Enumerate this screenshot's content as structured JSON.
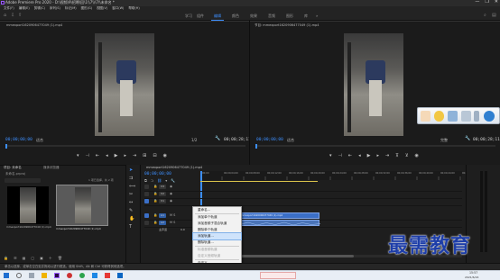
{
  "window": {
    "title": "Adobe Premiere Pro 2020 - D:\\视频\\9\\招聘\\回\\1\\\\7\\\\\\7\\\\未命名 *",
    "controls": [
      "—",
      "❐",
      "✕"
    ]
  },
  "menubar": [
    "文件(F)",
    "编辑(E)",
    "剪辑(C)",
    "序列(S)",
    "标记(M)",
    "图形(G)",
    "视图(V)",
    "窗口(W)",
    "帮助(H)"
  ],
  "workspaces": {
    "tabs": [
      "学习",
      "组件",
      "编辑",
      "颜色",
      "效果",
      "音频",
      "图形",
      "库",
      "»"
    ],
    "active": "编辑"
  },
  "source_monitor": {
    "tab": "源: (无剪辑)",
    "clip_tab": "mmexport1620906477049 (1).mp4",
    "timecode_left": "00;00;00;00",
    "fit": "适合",
    "ratio": "1/2",
    "timecode_right": "00;00;28;11"
  },
  "program_monitor": {
    "tab": "节目: mmexport1620906477049 (1).mp4",
    "timecode_left": "00;00;00;00",
    "fit": "适合",
    "ratio": "完整",
    "timecode_right": "00;00;28;11"
  },
  "project_panel": {
    "tabs": [
      "项目: 未命名",
      "媒体浏览器"
    ],
    "filename": "未命名.prproj",
    "item_count": "1 项已选择，共 2 项",
    "items": [
      {
        "name": "mmexport1620906477049 (1).mp4",
        "duration": "28;11"
      },
      {
        "name": "mmexport1620906477049 (1).mp4",
        "duration": "28;11"
      }
    ]
  },
  "timeline": {
    "tab": "mmexport1620906477049 (1).mp4",
    "timecode": "00;00;00;00",
    "ruler": [
      "00;00",
      "00;00;04;00",
      "00;00;08;00",
      "00;00;12;00",
      "00;00;16;00",
      "00;00;20;00",
      "00;00;24;00",
      "00;00;28;00",
      "00;00;32;00",
      "00;00;36;00",
      "00;00;40;00",
      "00;00;44;00",
      "00;00;48;00"
    ],
    "tracks": [
      {
        "name": "V3",
        "kind": "video"
      },
      {
        "name": "V2",
        "kind": "video"
      },
      {
        "name": "V1",
        "kind": "video"
      },
      {
        "name": "A1",
        "kind": "audio"
      },
      {
        "name": "A2",
        "kind": "audio"
      },
      {
        "name": "A3",
        "kind": "audio"
      }
    ],
    "master": "主声道",
    "master_value": "0.0",
    "clip_label": "mmexport1620906477049 (1).mp4"
  },
  "context_menu": {
    "items": [
      {
        "label": "重命名...",
        "state": "normal"
      },
      {
        "label": "添加单个轨道",
        "state": "normal"
      },
      {
        "label": "添加音频子混合轨道",
        "state": "normal"
      },
      {
        "label": "删除单个轨道",
        "state": "normal"
      },
      {
        "label": "添加轨道...",
        "state": "highlighted"
      },
      {
        "label": "删除轨道...",
        "state": "normal"
      },
      {
        "label": "标准音频轨道",
        "state": "disabled"
      },
      {
        "label": "自定义音频轨道",
        "state": "disabled"
      },
      {
        "label": "自定义...",
        "state": "normal"
      }
    ]
  },
  "statusbar": {
    "text": "单击以选择，或单击空白处并拖动以进行框选。使用 Shift、Alt 和 Ctrl 可获得其他选项。"
  },
  "taskbar": {
    "time": "15:57",
    "date": "2021/6/24"
  },
  "watermark": "最需教育",
  "colors": {
    "accent_blue": "#3d8fff",
    "clip_blue": "#3b6fc7",
    "audio_blue": "#4a74b8",
    "video_green": "#6bbb6b",
    "watermark_blue": "#1e3ea8",
    "highlight": "#cfe3fb"
  }
}
